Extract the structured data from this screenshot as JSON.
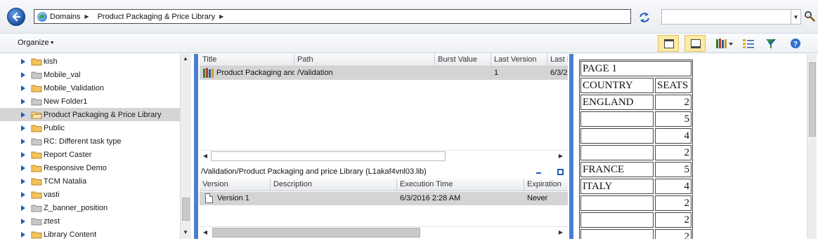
{
  "address_bar": {
    "crumbs": [
      "Domains",
      "Product Packaging & Price Library"
    ]
  },
  "search": {
    "value": "",
    "placeholder": ""
  },
  "toolbar": {
    "organize_label": "Organize"
  },
  "tree": {
    "items": [
      {
        "label": "kish",
        "selected": false
      },
      {
        "label": "Mobile_val",
        "selected": false
      },
      {
        "label": "Mobile_Validation",
        "selected": false
      },
      {
        "label": "New Folder1",
        "selected": false
      },
      {
        "label": "Product Packaging & Price Library",
        "selected": true
      },
      {
        "label": "Public",
        "selected": false
      },
      {
        "label": "RC: Different task type",
        "selected": false
      },
      {
        "label": "Report Caster",
        "selected": false
      },
      {
        "label": "Responsive Demo",
        "selected": false
      },
      {
        "label": "TCM Natalia",
        "selected": false
      },
      {
        "label": "vasti",
        "selected": false
      },
      {
        "label": "Z_banner_position",
        "selected": false
      },
      {
        "label": "ztest",
        "selected": false
      },
      {
        "label": "Library Content",
        "selected": false
      }
    ]
  },
  "grid": {
    "columns": [
      "Title",
      "Path",
      "Burst Value",
      "Last Version",
      "Last E"
    ],
    "rows": [
      {
        "title": "Product Packaging and",
        "path": "/Validation",
        "burst": "",
        "last_version": "1",
        "last_exec": "6/3/2"
      }
    ]
  },
  "versions": {
    "title": "/Validation/Product Packaging and price Library (L1akaf4vnl03.lib)",
    "columns": [
      "Version",
      "Description",
      "Execution Time",
      "Expiration"
    ],
    "rows": [
      {
        "version": "Version 1",
        "description": "",
        "exec_time": "6/3/2016 2:28 AM",
        "expiration": "Never"
      }
    ]
  },
  "report": {
    "page_label": "PAGE 1",
    "headers": [
      "COUNTRY",
      "SEATS"
    ],
    "rows": [
      {
        "country": "ENGLAND",
        "seats": "2"
      },
      {
        "country": "",
        "seats": "5"
      },
      {
        "country": "",
        "seats": "4"
      },
      {
        "country": "",
        "seats": "2"
      },
      {
        "country": "FRANCE",
        "seats": "5"
      },
      {
        "country": "ITALY",
        "seats": "4"
      },
      {
        "country": "",
        "seats": "2"
      },
      {
        "country": "",
        "seats": "2"
      },
      {
        "country": "",
        "seats": "2"
      }
    ]
  }
}
